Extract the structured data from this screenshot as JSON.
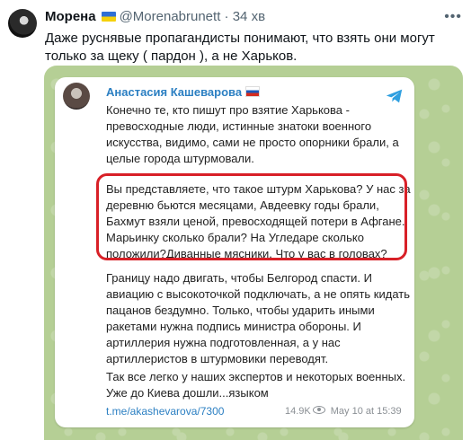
{
  "tweet": {
    "author_name": "Морена",
    "handle": "@Morenabrunett",
    "separator": "·",
    "time": "34 хв",
    "text": "Даже руснявые пропагандисты понимают, что взять они могут только за щеку ( пардон ), а не Харьков.",
    "more_icon": "more-dots-icon"
  },
  "telegram_post": {
    "channel_name": "Анастасия Кашеварова",
    "paragraphs": [
      "Конечно те, кто пишут про взятие Харькова - превосходные люди, истинные знатоки военного искусства, видимо, сами не просто опорники брали, а целые города штурмовали.",
      "Вы представляете, что такое штурм Харькова? У нас за деревню бьются месяцами, Авдеевку годы брали, Бахмут взяли ценой, превосходящей потери в Афгане. Марьинку сколько брали? На Угледаре сколько положили?Диванные мясники. Что у вас в головах?",
      "Границу надо двигать, чтобы Белгород спасти. И авиацию с высокоточкой подключать, а не опять кидать пацанов бездумно. Только, чтобы ударить иными ракетами нужна подпись министра обороны. И артиллерия нужна подготовленная, а у нас артиллеристов в штурмовики переводят.",
      "Так все легко у наших экспертов и некоторых военных. Уже до Киева дошли...языком"
    ],
    "link": "t.me/akashevarova/7300",
    "views": "14.9K",
    "date": "May 10 at 15:39",
    "highlight_color": "#d82027",
    "link_color": "#2b7fc2"
  }
}
